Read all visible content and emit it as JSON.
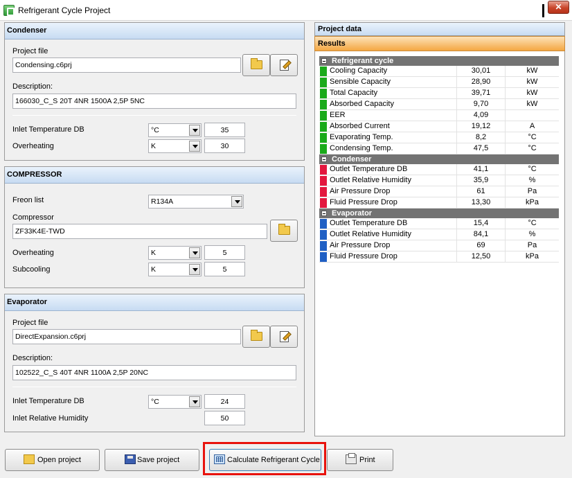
{
  "window": {
    "title": "Refrigerant Cycle Project",
    "close_label": "✕"
  },
  "condenser": {
    "title": "Condenser",
    "project_file_label": "Project file",
    "project_file_value": "Condensing.c6prj",
    "description_label": "Description:",
    "description_value": "166030_C_S 20T 4NR 1500A 2,5P 5NC",
    "inlet_temp_label": "Inlet Temperature DB",
    "inlet_temp_unit": "°C",
    "inlet_temp_value": "35",
    "overheating_label": "Overheating",
    "overheating_unit": "K",
    "overheating_value": "30"
  },
  "compressor": {
    "title": "COMPRESSOR",
    "freon_label": "Freon list",
    "freon_value": "R134A",
    "compressor_label": "Compressor",
    "compressor_value": "ZF33K4E-TWD",
    "overheating_label": "Overheating",
    "overheating_unit": "K",
    "overheating_value": "5",
    "subcooling_label": "Subcooling",
    "subcooling_unit": "K",
    "subcooling_value": "5"
  },
  "evaporator": {
    "title": "Evaporator",
    "project_file_label": "Project file",
    "project_file_value": "DirectExpansion.c6prj",
    "description_label": "Description:",
    "description_value": "102522_C_S 40T 4NR 1100A 2,5P 20NC",
    "inlet_temp_label": "Inlet Temperature DB",
    "inlet_temp_unit": "°C",
    "inlet_temp_value": "24",
    "inlet_rh_label": "Inlet Relative Humidity",
    "inlet_rh_value": "50"
  },
  "project_data": {
    "title": "Project data",
    "results_title": "Results",
    "groups": [
      {
        "name": "Refrigerant cycle",
        "color": "#1aaa1a",
        "rows": [
          {
            "name": "Cooling Capacity",
            "value": "30,01",
            "unit": "kW"
          },
          {
            "name": "Sensible Capacity",
            "value": "28,90",
            "unit": "kW"
          },
          {
            "name": "Total Capacity",
            "value": "39,71",
            "unit": "kW"
          },
          {
            "name": "Absorbed Capacity",
            "value": "9,70",
            "unit": "kW"
          },
          {
            "name": "EER",
            "value": "4,09",
            "unit": ""
          },
          {
            "name": "Absorbed Current",
            "value": "19,12",
            "unit": "A"
          },
          {
            "name": "Evaporating Temp.",
            "value": "8,2",
            "unit": "°C"
          },
          {
            "name": "Condensing Temp.",
            "value": "47,5",
            "unit": "°C"
          }
        ]
      },
      {
        "name": "Condenser",
        "color": "#e3173e",
        "rows": [
          {
            "name": "Outlet Temperature DB",
            "value": "41,1",
            "unit": "°C"
          },
          {
            "name": "Outlet Relative Humidity",
            "value": "35,9",
            "unit": "%"
          },
          {
            "name": "Air Pressure Drop",
            "value": "61",
            "unit": "Pa"
          },
          {
            "name": "Fluid Pressure Drop",
            "value": "13,30",
            "unit": "kPa"
          }
        ]
      },
      {
        "name": "Evaporator",
        "color": "#1f5fc4",
        "rows": [
          {
            "name": "Outlet Temperature DB",
            "value": "15,4",
            "unit": "°C"
          },
          {
            "name": "Outlet Relative Humidity",
            "value": "84,1",
            "unit": "%"
          },
          {
            "name": "Air Pressure Drop",
            "value": "69",
            "unit": "Pa"
          },
          {
            "name": "Fluid Pressure Drop",
            "value": "12,50",
            "unit": "kPa"
          }
        ]
      }
    ]
  },
  "buttons": {
    "open_project": "Open project",
    "save_project": "Save project",
    "calculate": "Calculate Refrigerant Cycle",
    "print": "Print"
  },
  "highlight_color": "#e8120c"
}
